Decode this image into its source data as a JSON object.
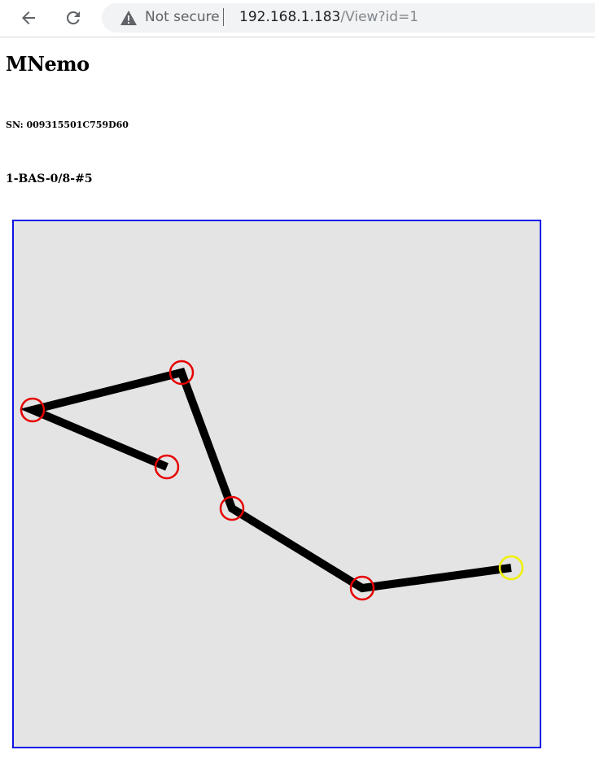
{
  "browser": {
    "security_label": "Not secure",
    "url_host": "192.168.1.183",
    "url_path": "/View?id=1",
    "back_icon": "back-arrow-icon",
    "reload_icon": "reload-icon",
    "warning_icon": "warning-icon"
  },
  "page": {
    "title": "MNemo",
    "serial": "SN: 009315501C759D60",
    "device": "1-BAS-0/8-#5"
  },
  "diagram": {
    "colors": {
      "background": "#e4e4e4",
      "border": "#1010e6",
      "path": "#000000",
      "node": "#e60000",
      "active_node": "#f0f000"
    }
  }
}
